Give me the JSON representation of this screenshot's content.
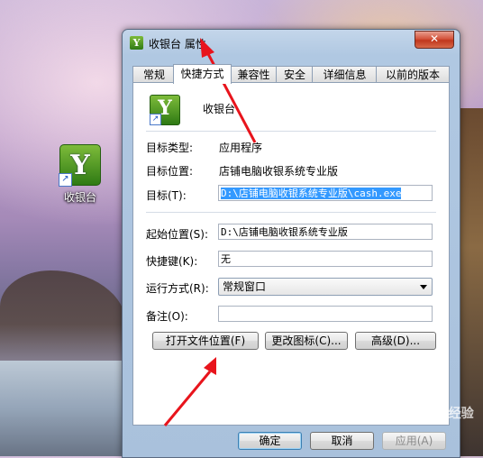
{
  "desktop": {
    "icon_label": "收银台"
  },
  "window": {
    "title": "收银台 属性",
    "close_glyph": "✕",
    "tabs": [
      "常规",
      "快捷方式",
      "兼容性",
      "安全",
      "详细信息",
      "以前的版本"
    ],
    "active_tab": "快捷方式"
  },
  "shortcut": {
    "name": "收银台",
    "target_type_label": "目标类型:",
    "target_type_value": "应用程序",
    "target_location_label": "目标位置:",
    "target_location_value": "店铺电脑收银系统专业版",
    "target_label": "目标(T):",
    "target_value": "D:\\店铺电脑收银系统专业版\\cash.exe",
    "start_in_label": "起始位置(S):",
    "start_in_value": "D:\\店铺电脑收银系统专业版",
    "hotkey_label": "快捷键(K):",
    "hotkey_value": "无",
    "run_label": "运行方式(R):",
    "run_value": "常规窗口",
    "comment_label": "备注(O):",
    "comment_value": "",
    "open_location_btn": "打开文件位置(F)",
    "change_icon_btn": "更改图标(C)...",
    "advanced_btn": "高级(D)..."
  },
  "footer": {
    "ok": "确定",
    "cancel": "取消",
    "apply": "应用(A)"
  },
  "annotation": {
    "arrow_color": "#e8141c"
  },
  "watermark": "Baidu 经验"
}
